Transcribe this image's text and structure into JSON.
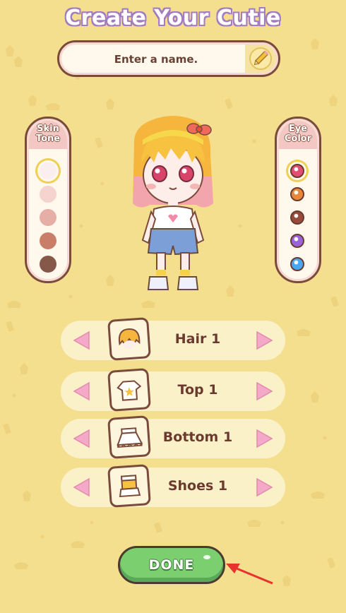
{
  "title": "Create Your Cutie",
  "name_field": {
    "placeholder": "Enter a name.",
    "value": ""
  },
  "skin_tone": {
    "label": "Skin Tone",
    "colors": [
      "#fbeeee",
      "#f5d3cf",
      "#e5aea6",
      "#c97e6a",
      "#85584a"
    ],
    "selected_index": 0
  },
  "eye_color": {
    "label": "Eye Color",
    "colors": [
      "#e04f72",
      "#e8893a",
      "#9a4a3a",
      "#9b63d8",
      "#4aa6ee"
    ],
    "selected_index": 0
  },
  "options": [
    {
      "label": "Hair 1",
      "icon": "hair-icon"
    },
    {
      "label": "Top 1",
      "icon": "shirt-icon"
    },
    {
      "label": "Bottom 1",
      "icon": "skirt-icon"
    },
    {
      "label": "Shoes 1",
      "icon": "shoes-icon"
    }
  ],
  "done_label": "DONE",
  "colors": {
    "background": "#f4df8f",
    "outline": "#7a4a3a",
    "arrow_pink": "#f2a8c8",
    "done_green": "#7ccf6f"
  }
}
